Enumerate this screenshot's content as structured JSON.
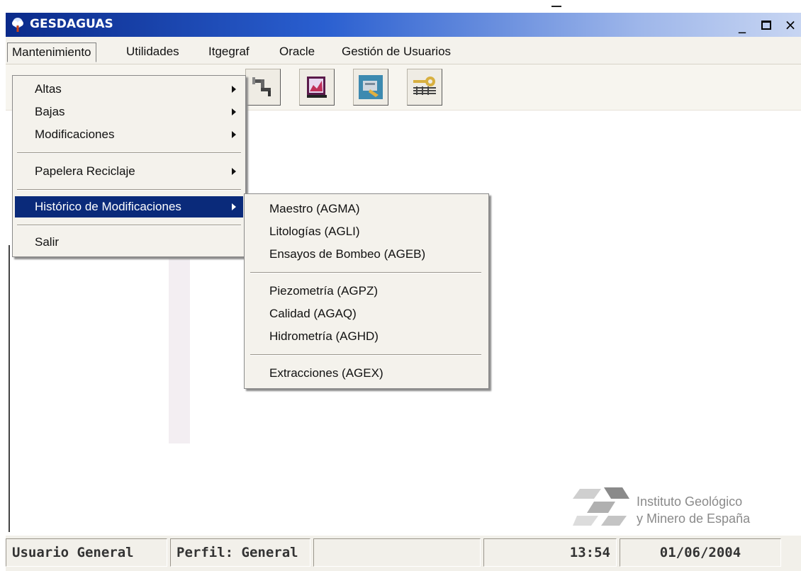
{
  "window": {
    "title": "GESDAGUAS",
    "min_glyph": "_",
    "close_glyph": "×"
  },
  "menubar": {
    "items": [
      "Mantenimiento",
      "Utilidades",
      "Itgegraf",
      "Oracle",
      "Gestión de Usuarios"
    ]
  },
  "dropdown": {
    "items": [
      "Altas",
      "Bajas",
      "Modificaciones",
      "Papelera Reciclaje",
      "Histórico de Modificaciones",
      "Salir"
    ]
  },
  "submenu": {
    "items": [
      "Maestro (AGMA)",
      "Litologías (AGLI)",
      "Ensayos de Bombeo (AGEB)",
      "Piezometría (AGPZ)",
      "Calidad (AGAQ)",
      "Hidrometría (AGHD)",
      "Extracciones (AGEX)"
    ]
  },
  "toolbar": {
    "icons": [
      "faucet-icon",
      "chart-book-icon",
      "database-tool-icon",
      "key-grid-icon"
    ]
  },
  "logo": {
    "line1": "Instituto Geológico",
    "line2": "y Minero de España"
  },
  "statusbar": {
    "user": "Usuario General",
    "profile": "Perfil: General",
    "empty": "",
    "time": "13:54",
    "date": "01/06/2004"
  },
  "colors": {
    "title_gradient_start": "#0a2a8a",
    "highlight": "#0a2a7a",
    "menu_bg": "#f4f2ec"
  }
}
